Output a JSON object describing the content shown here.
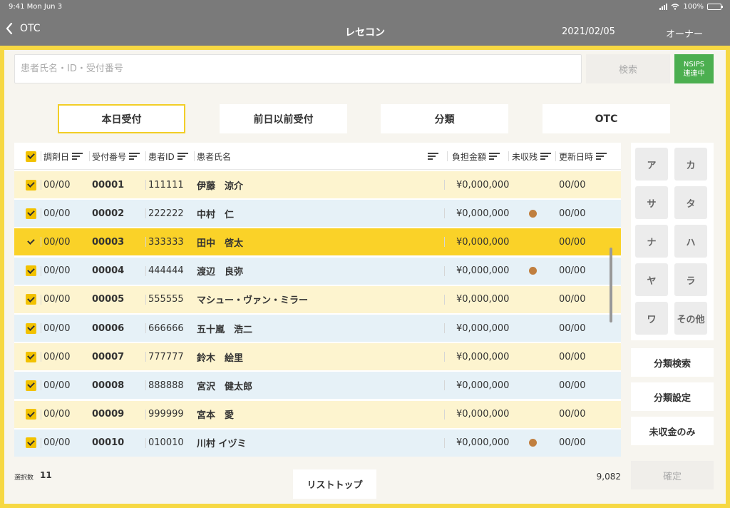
{
  "status_bar": {
    "time": "9:41 Mon Jun 3",
    "battery": "100%"
  },
  "nav": {
    "back_label": "OTC",
    "title": "レセコン",
    "date": "2021/02/05",
    "user": "オーナー"
  },
  "search": {
    "placeholder": "患者氏名・ID・受付番号",
    "button_label": "検索"
  },
  "nsips": {
    "line1": "NSIPS",
    "line2": "連達中",
    "color": "#4caf50"
  },
  "tabs": [
    {
      "label": "本日受付",
      "active": true
    },
    {
      "label": "前日以前受付",
      "active": false
    },
    {
      "label": "分類",
      "active": false
    },
    {
      "label": "OTC",
      "active": false
    }
  ],
  "table": {
    "headers": {
      "date": "調剤日",
      "receipt": "受付番号",
      "patient_id": "患者ID",
      "name": "患者氏名",
      "amount": "負担金額",
      "unpaid": "未収残",
      "updated": "更新日時"
    },
    "rows": [
      {
        "date": "00/00",
        "receipt": "00001",
        "patient_id": "111111",
        "name": "伊藤　涼介",
        "amount": "¥0,000,000",
        "unpaid": false,
        "updated": "00/00",
        "selected": false
      },
      {
        "date": "00/00",
        "receipt": "00002",
        "patient_id": "222222",
        "name": "中村　仁",
        "amount": "¥0,000,000",
        "unpaid": true,
        "updated": "00/00",
        "selected": false
      },
      {
        "date": "00/00",
        "receipt": "00003",
        "patient_id": "333333",
        "name": "田中　啓太",
        "amount": "¥0,000,000",
        "unpaid": false,
        "updated": "00/00",
        "selected": true
      },
      {
        "date": "00/00",
        "receipt": "00004",
        "patient_id": "444444",
        "name": "渡辺　良弥",
        "amount": "¥0,000,000",
        "unpaid": true,
        "updated": "00/00",
        "selected": false
      },
      {
        "date": "00/00",
        "receipt": "00005",
        "patient_id": "555555",
        "name": "マシュー・ヴァン・ミラー",
        "amount": "¥0,000,000",
        "unpaid": false,
        "updated": "00/00",
        "selected": false
      },
      {
        "date": "00/00",
        "receipt": "00006",
        "patient_id": "666666",
        "name": "五十嵐　浩二",
        "amount": "¥0,000,000",
        "unpaid": false,
        "updated": "00/00",
        "selected": false
      },
      {
        "date": "00/00",
        "receipt": "00007",
        "patient_id": "777777",
        "name": "鈴木　絵里",
        "amount": "¥0,000,000",
        "unpaid": false,
        "updated": "00/00",
        "selected": false
      },
      {
        "date": "00/00",
        "receipt": "00008",
        "patient_id": "888888",
        "name": "宮沢　健太郎",
        "amount": "¥0,000,000",
        "unpaid": false,
        "updated": "00/00",
        "selected": false
      },
      {
        "date": "00/00",
        "receipt": "00009",
        "patient_id": "999999",
        "name": "宮本　愛",
        "amount": "¥0,000,000",
        "unpaid": false,
        "updated": "00/00",
        "selected": false
      },
      {
        "date": "00/00",
        "receipt": "00010",
        "patient_id": "010010",
        "name": "川村 イヅミ",
        "amount": "¥0,000,000",
        "unpaid": true,
        "updated": "00/00",
        "selected": false
      }
    ]
  },
  "kana": [
    "ア",
    "カ",
    "サ",
    "タ",
    "ナ",
    "ハ",
    "ヤ",
    "ラ",
    "ワ",
    "その他"
  ],
  "side_buttons": [
    "分類検索",
    "分類設定",
    "未収金のみ"
  ],
  "confirm_label": "確定",
  "footer": {
    "selected_label": "選択数",
    "selected_count": "11",
    "list_top_label": "リストトップ",
    "total": "9,082"
  },
  "colors": {
    "frame": "#f6d843",
    "selected_row": "#fad228",
    "row_yellow": "#fdf4cf",
    "row_blue": "#e6f1f7",
    "unpaid_dot": "#c07f3f"
  }
}
